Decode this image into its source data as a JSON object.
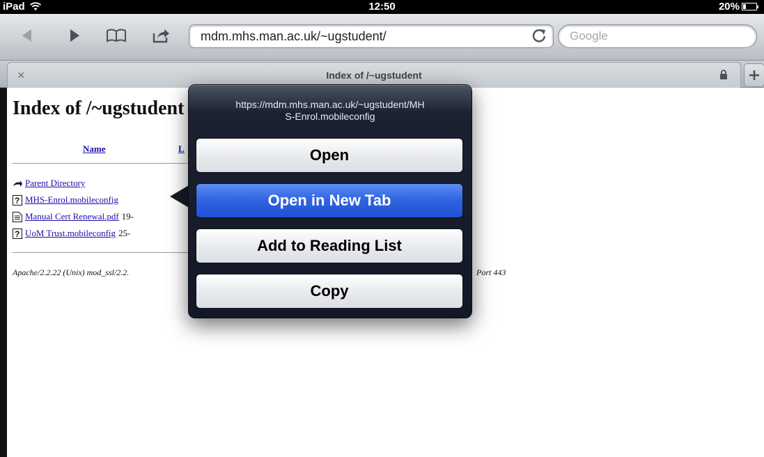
{
  "status_bar": {
    "carrier": "iPad",
    "time": "12:50",
    "battery_text": "20%",
    "battery_level": 0.2
  },
  "toolbar": {
    "url": "mdm.mhs.man.ac.uk/~ugstudent/",
    "search_placeholder": "Google"
  },
  "tab": {
    "title": "Index of /~ugstudent",
    "close_symbol": "×"
  },
  "page": {
    "heading": "Index of /~ugstudent",
    "columns": [
      "Name",
      "L"
    ],
    "entries": [
      {
        "name": "Parent Directory",
        "meta": "",
        "icon": "back-arrow-icon"
      },
      {
        "name": "MHS-Enrol.mobileconfig",
        "meta": "",
        "icon": "unknown-file-icon"
      },
      {
        "name": "Manual Cert Renewal.pdf",
        "meta": "19-",
        "icon": "document-icon"
      },
      {
        "name": "UoM Trust.mobileconfig",
        "meta": "25-",
        "icon": "unknown-file-icon"
      }
    ],
    "footer_left": "Apache/2.2.22 (Unix) mod_ssl/2.2.",
    "footer_right": "Port 443"
  },
  "popover": {
    "url": "https://mdm.mhs.man.ac.uk/~ugstudent/MH S-Enrol.mobileconfig",
    "url_line1": "https://mdm.mhs.man.ac.uk/~ugstudent/MH",
    "url_line2": "S-Enrol.mobileconfig",
    "actions": [
      "Open",
      "Open in New Tab",
      "Add to Reading List",
      "Copy"
    ],
    "selected_action": "Open in New Tab"
  }
}
